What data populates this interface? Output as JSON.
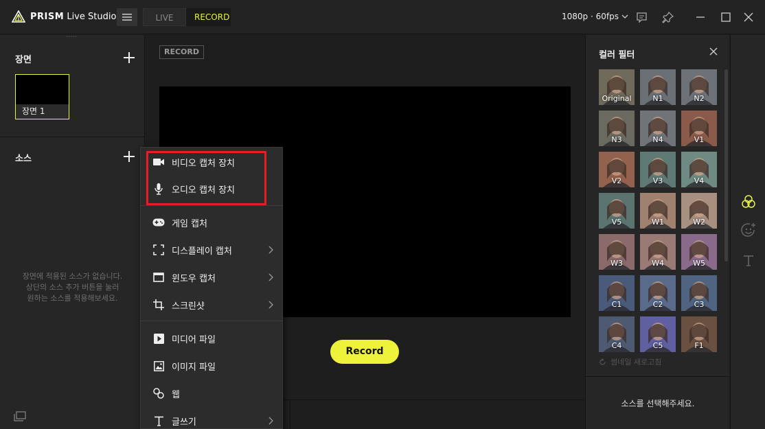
{
  "app": {
    "logo_bold": "PRISM",
    "logo_rest": " Live Studio"
  },
  "mode_tabs": {
    "live": "LIVE",
    "record": "RECORD"
  },
  "resolution": "1080p · 60fps",
  "left_panel": {
    "scenes_title": "장면",
    "scene_item": "장면 1",
    "sources_title": "소스",
    "empty_lines": [
      "장면에 적용된 소스가 없습니다.",
      "상단의 소스 추가 버튼을 눌러",
      "원하는 소스를 적용해보세요."
    ]
  },
  "center": {
    "badge": "RECORD",
    "record_button": "Record"
  },
  "source_menu": {
    "items": [
      {
        "label": "비디오 캡처 장치",
        "icon": "video-camera-icon",
        "submenu": false
      },
      {
        "label": "오디오 캡처 장치",
        "icon": "microphone-icon",
        "submenu": false
      },
      {
        "label": "게임 캡처",
        "icon": "gamepad-icon",
        "submenu": false
      },
      {
        "label": "디스플레이 캡처",
        "icon": "display-frame-icon",
        "submenu": true
      },
      {
        "label": "윈도우 캡처",
        "icon": "window-icon",
        "submenu": true
      },
      {
        "label": "스크린샷",
        "icon": "crop-icon",
        "submenu": true
      },
      {
        "label": "미디어 파일",
        "icon": "play-icon",
        "submenu": false
      },
      {
        "label": "이미지 파일",
        "icon": "image-icon",
        "submenu": false
      },
      {
        "label": "웹",
        "icon": "link-icon",
        "submenu": false
      },
      {
        "label": "글쓰기",
        "icon": "text-icon",
        "submenu": true
      }
    ],
    "highlight_color": "#e81c24"
  },
  "color_filter": {
    "title": "컬러 필터",
    "filters": [
      "Original",
      "N1",
      "N2",
      "N3",
      "N4",
      "V1",
      "V2",
      "V3",
      "V4",
      "V5",
      "W1",
      "W2",
      "W3",
      "W4",
      "W5",
      "C1",
      "C2",
      "C3",
      "C4",
      "C5",
      "F1"
    ],
    "refresh_label": "썸네일 새로고침",
    "message": "소스를 선택해주세요."
  },
  "colors": {
    "accent": "#e6f14a",
    "record_button": "#eef23a",
    "panel_bg": "#262626"
  }
}
